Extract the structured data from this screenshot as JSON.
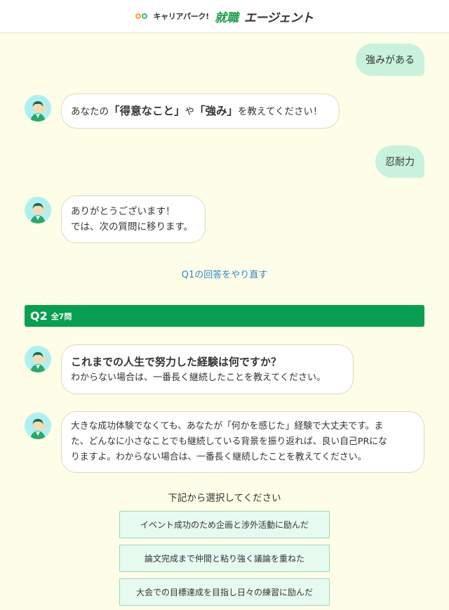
{
  "header": {
    "brand": "キャリアパーク!",
    "job": "就職",
    "agent": "エージェント"
  },
  "chat": {
    "user1": "強みがある",
    "bot1": {
      "pre": "あなたの",
      "em1": "「得意なこと」",
      "mid": "や",
      "em2": "「強み」",
      "post": "を教えてください！"
    },
    "user2": "忍耐力",
    "bot2": {
      "line1": "ありがとうございます！",
      "line2": "では、次の質問に移ります。"
    },
    "redo": "Q1の回答をやり直す"
  },
  "question": {
    "number": "Q2",
    "total": "全7問",
    "title": "これまでの人生で努力した経験は何ですか？",
    "sub": "わからない場合は、一番長く継続したことを教えてください。",
    "hint_line1": "大きな成功体験でなくても、あなたが「何かを感じた」経験で大丈夫です。ま",
    "hint_line2": "た、どんなに小さなことでも継続している背景を振り返れば、良い自己PRにな",
    "hint_line3": "りますよ。わからない場合は、一番長く継続したことを教えてください。"
  },
  "selection": {
    "label": "下記から選択してください",
    "options": [
      "イベント成功のため企画と渉外活動に励んだ",
      "論文完成まで仲間と粘り強く議論を重ねた",
      "大会での目標達成を目指し日々の練習に励んだ"
    ]
  },
  "colors": {
    "background": "#fefee8",
    "user_bubble": "#c9f2dc",
    "accent_green": "#08a050",
    "link_blue": "#2f86c4",
    "choice_bg": "#e6faf0"
  }
}
